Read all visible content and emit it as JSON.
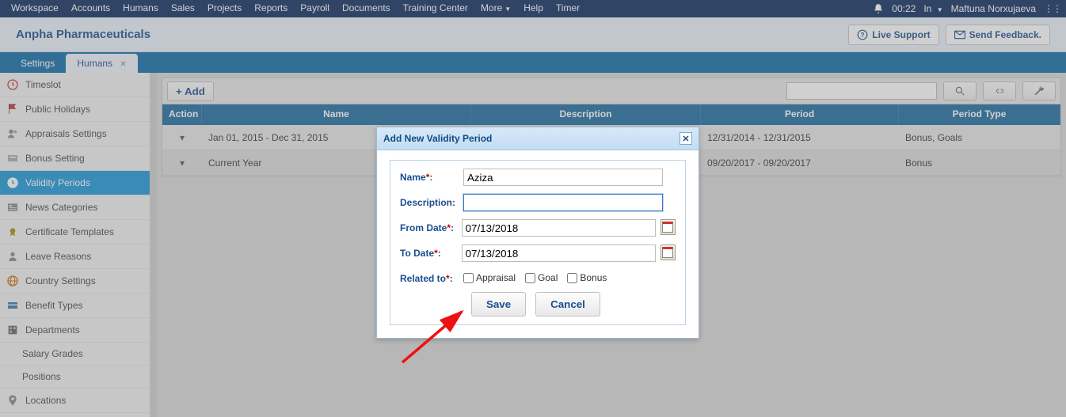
{
  "topnav": {
    "items": [
      "Workspace",
      "Accounts",
      "Humans",
      "Sales",
      "Projects",
      "Reports",
      "Payroll",
      "Documents",
      "Training Center",
      "More",
      "Help",
      "Timer"
    ],
    "time": "00:22",
    "status": "In",
    "user": "Maftuna Norxujaeva"
  },
  "company": {
    "name": "Anpha Pharmaceuticals",
    "live_support": "Live Support",
    "send_feedback": "Send Feedback."
  },
  "tabs": [
    {
      "label": "Settings",
      "active": false
    },
    {
      "label": "Humans",
      "active": true
    }
  ],
  "sidebar": {
    "items": [
      {
        "icon": "clock",
        "label": "Timeslot"
      },
      {
        "icon": "flag",
        "label": "Public Holidays"
      },
      {
        "icon": "appraisal",
        "label": "Appraisals Settings"
      },
      {
        "icon": "bonus",
        "label": "Bonus Setting"
      },
      {
        "icon": "validity",
        "label": "Validity Periods",
        "active": true
      },
      {
        "icon": "news",
        "label": "News Categories"
      },
      {
        "icon": "cert",
        "label": "Certificate Templates"
      },
      {
        "icon": "leave",
        "label": "Leave Reasons"
      },
      {
        "icon": "globe",
        "label": "Country Settings"
      },
      {
        "icon": "benefit",
        "label": "Benefit Types"
      },
      {
        "icon": "dept",
        "label": "Departments"
      },
      {
        "icon": "",
        "label": "Salary Grades",
        "sub": true
      },
      {
        "icon": "",
        "label": "Positions",
        "sub": true
      },
      {
        "icon": "loc",
        "label": "Locations"
      }
    ]
  },
  "toolbar": {
    "add": "+ Add"
  },
  "table": {
    "headers": {
      "action": "Action",
      "name": "Name",
      "desc": "Description",
      "period": "Period",
      "type": "Period Type"
    },
    "rows": [
      {
        "name": "Jan 01, 2015 - Dec 31, 2015",
        "desc": "",
        "period": "12/31/2014 - 12/31/2015",
        "type": "Bonus, Goals"
      },
      {
        "name": "Current Year",
        "desc": "",
        "period": "09/20/2017 - 09/20/2017",
        "type": "Bonus"
      }
    ]
  },
  "dialog": {
    "title": "Add New Validity Period",
    "name_label": "Name",
    "name_value": "Aziza",
    "desc_label": "Description:",
    "desc_value": "",
    "from_label": "From Date",
    "from_value": "07/13/2018",
    "to_label": "To Date",
    "to_value": "07/13/2018",
    "related_label": "Related to",
    "chk": {
      "appraisal": "Appraisal",
      "goal": "Goal",
      "bonus": "Bonus"
    },
    "save": "Save",
    "cancel": "Cancel"
  }
}
